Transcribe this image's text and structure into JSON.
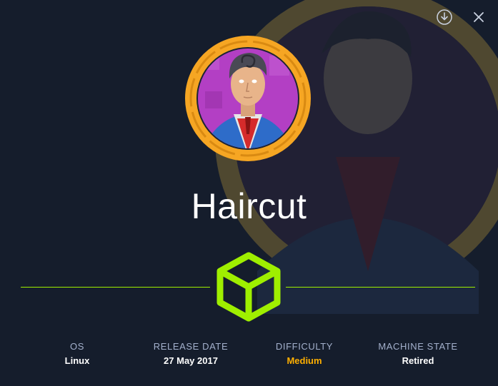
{
  "machine": {
    "name": "Haircut"
  },
  "actions": {
    "download_icon": "download-circle-icon",
    "close_icon": "close-icon"
  },
  "stats": [
    {
      "label": "OS",
      "value": "Linux"
    },
    {
      "label": "RELEASE DATE",
      "value": "27 May 2017"
    },
    {
      "label": "DIFFICULTY",
      "value": "Medium"
    },
    {
      "label": "MACHINE STATE",
      "value": "Retired"
    }
  ],
  "colors": {
    "background": "#151d2c",
    "accent_green": "#9fef00",
    "difficulty_medium": "#ffaf00",
    "ring_orange": "#f6a623",
    "label": "#a4b1cd"
  }
}
